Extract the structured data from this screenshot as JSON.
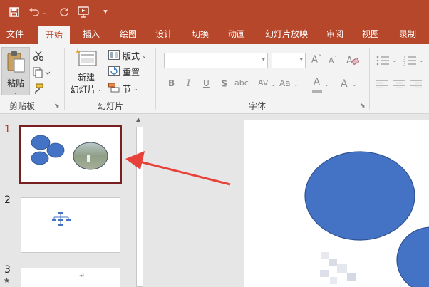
{
  "tabs": [
    {
      "label": "文件",
      "active": false
    },
    {
      "label": "开始",
      "active": true
    },
    {
      "label": "插入",
      "active": false
    },
    {
      "label": "绘图",
      "active": false
    },
    {
      "label": "设计",
      "active": false
    },
    {
      "label": "切换",
      "active": false
    },
    {
      "label": "动画",
      "active": false
    },
    {
      "label": "幻灯片放映",
      "active": false
    },
    {
      "label": "审阅",
      "active": false
    },
    {
      "label": "视图",
      "active": false
    },
    {
      "label": "录制",
      "active": false
    }
  ],
  "ribbon": {
    "clipboard": {
      "paste_label": "粘贴",
      "group_label": "剪贴板"
    },
    "slides": {
      "new_slide_line1": "新建",
      "new_slide_line2": "幻灯片",
      "layout_label": "版式",
      "reset_label": "重置",
      "section_label": "节",
      "group_label": "幻灯片"
    },
    "font": {
      "group_label": "字体",
      "bold": "B",
      "italic": "I",
      "underline": "U",
      "shadow": "S",
      "strike": "abc",
      "spacing": "AV",
      "case": "Aa",
      "color": "A"
    }
  },
  "thumbnails": [
    {
      "number": "1",
      "selected": true
    },
    {
      "number": "2",
      "selected": false
    },
    {
      "number": "3",
      "selected": false,
      "marker": "★"
    }
  ],
  "colors": {
    "accent": "#b7472a",
    "shape_blue": "#4472c4",
    "arrow_red": "#e8413a",
    "selected_border": "#7a1f1f"
  }
}
